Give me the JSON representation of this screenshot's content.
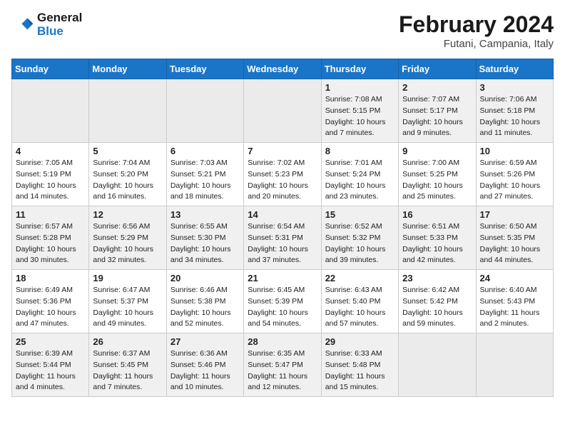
{
  "logo": {
    "text_general": "General",
    "text_blue": "Blue"
  },
  "title": "February 2024",
  "location": "Futani, Campania, Italy",
  "days_of_week": [
    "Sunday",
    "Monday",
    "Tuesday",
    "Wednesday",
    "Thursday",
    "Friday",
    "Saturday"
  ],
  "weeks": [
    [
      {
        "day": "",
        "empty": true
      },
      {
        "day": "",
        "empty": true
      },
      {
        "day": "",
        "empty": true
      },
      {
        "day": "",
        "empty": true
      },
      {
        "day": "1",
        "empty": false,
        "detail": "Sunrise: 7:08 AM\nSunset: 5:15 PM\nDaylight: 10 hours\nand 7 minutes."
      },
      {
        "day": "2",
        "empty": false,
        "detail": "Sunrise: 7:07 AM\nSunset: 5:17 PM\nDaylight: 10 hours\nand 9 minutes."
      },
      {
        "day": "3",
        "empty": false,
        "detail": "Sunrise: 7:06 AM\nSunset: 5:18 PM\nDaylight: 10 hours\nand 11 minutes."
      }
    ],
    [
      {
        "day": "4",
        "empty": false,
        "detail": "Sunrise: 7:05 AM\nSunset: 5:19 PM\nDaylight: 10 hours\nand 14 minutes."
      },
      {
        "day": "5",
        "empty": false,
        "detail": "Sunrise: 7:04 AM\nSunset: 5:20 PM\nDaylight: 10 hours\nand 16 minutes."
      },
      {
        "day": "6",
        "empty": false,
        "detail": "Sunrise: 7:03 AM\nSunset: 5:21 PM\nDaylight: 10 hours\nand 18 minutes."
      },
      {
        "day": "7",
        "empty": false,
        "detail": "Sunrise: 7:02 AM\nSunset: 5:23 PM\nDaylight: 10 hours\nand 20 minutes."
      },
      {
        "day": "8",
        "empty": false,
        "detail": "Sunrise: 7:01 AM\nSunset: 5:24 PM\nDaylight: 10 hours\nand 23 minutes."
      },
      {
        "day": "9",
        "empty": false,
        "detail": "Sunrise: 7:00 AM\nSunset: 5:25 PM\nDaylight: 10 hours\nand 25 minutes."
      },
      {
        "day": "10",
        "empty": false,
        "detail": "Sunrise: 6:59 AM\nSunset: 5:26 PM\nDaylight: 10 hours\nand 27 minutes."
      }
    ],
    [
      {
        "day": "11",
        "empty": false,
        "detail": "Sunrise: 6:57 AM\nSunset: 5:28 PM\nDaylight: 10 hours\nand 30 minutes."
      },
      {
        "day": "12",
        "empty": false,
        "detail": "Sunrise: 6:56 AM\nSunset: 5:29 PM\nDaylight: 10 hours\nand 32 minutes."
      },
      {
        "day": "13",
        "empty": false,
        "detail": "Sunrise: 6:55 AM\nSunset: 5:30 PM\nDaylight: 10 hours\nand 34 minutes."
      },
      {
        "day": "14",
        "empty": false,
        "detail": "Sunrise: 6:54 AM\nSunset: 5:31 PM\nDaylight: 10 hours\nand 37 minutes."
      },
      {
        "day": "15",
        "empty": false,
        "detail": "Sunrise: 6:52 AM\nSunset: 5:32 PM\nDaylight: 10 hours\nand 39 minutes."
      },
      {
        "day": "16",
        "empty": false,
        "detail": "Sunrise: 6:51 AM\nSunset: 5:33 PM\nDaylight: 10 hours\nand 42 minutes."
      },
      {
        "day": "17",
        "empty": false,
        "detail": "Sunrise: 6:50 AM\nSunset: 5:35 PM\nDaylight: 10 hours\nand 44 minutes."
      }
    ],
    [
      {
        "day": "18",
        "empty": false,
        "detail": "Sunrise: 6:49 AM\nSunset: 5:36 PM\nDaylight: 10 hours\nand 47 minutes."
      },
      {
        "day": "19",
        "empty": false,
        "detail": "Sunrise: 6:47 AM\nSunset: 5:37 PM\nDaylight: 10 hours\nand 49 minutes."
      },
      {
        "day": "20",
        "empty": false,
        "detail": "Sunrise: 6:46 AM\nSunset: 5:38 PM\nDaylight: 10 hours\nand 52 minutes."
      },
      {
        "day": "21",
        "empty": false,
        "detail": "Sunrise: 6:45 AM\nSunset: 5:39 PM\nDaylight: 10 hours\nand 54 minutes."
      },
      {
        "day": "22",
        "empty": false,
        "detail": "Sunrise: 6:43 AM\nSunset: 5:40 PM\nDaylight: 10 hours\nand 57 minutes."
      },
      {
        "day": "23",
        "empty": false,
        "detail": "Sunrise: 6:42 AM\nSunset: 5:42 PM\nDaylight: 10 hours\nand 59 minutes."
      },
      {
        "day": "24",
        "empty": false,
        "detail": "Sunrise: 6:40 AM\nSunset: 5:43 PM\nDaylight: 11 hours\nand 2 minutes."
      }
    ],
    [
      {
        "day": "25",
        "empty": false,
        "detail": "Sunrise: 6:39 AM\nSunset: 5:44 PM\nDaylight: 11 hours\nand 4 minutes."
      },
      {
        "day": "26",
        "empty": false,
        "detail": "Sunrise: 6:37 AM\nSunset: 5:45 PM\nDaylight: 11 hours\nand 7 minutes."
      },
      {
        "day": "27",
        "empty": false,
        "detail": "Sunrise: 6:36 AM\nSunset: 5:46 PM\nDaylight: 11 hours\nand 10 minutes."
      },
      {
        "day": "28",
        "empty": false,
        "detail": "Sunrise: 6:35 AM\nSunset: 5:47 PM\nDaylight: 11 hours\nand 12 minutes."
      },
      {
        "day": "29",
        "empty": false,
        "detail": "Sunrise: 6:33 AM\nSunset: 5:48 PM\nDaylight: 11 hours\nand 15 minutes."
      },
      {
        "day": "",
        "empty": true
      },
      {
        "day": "",
        "empty": true
      }
    ]
  ]
}
